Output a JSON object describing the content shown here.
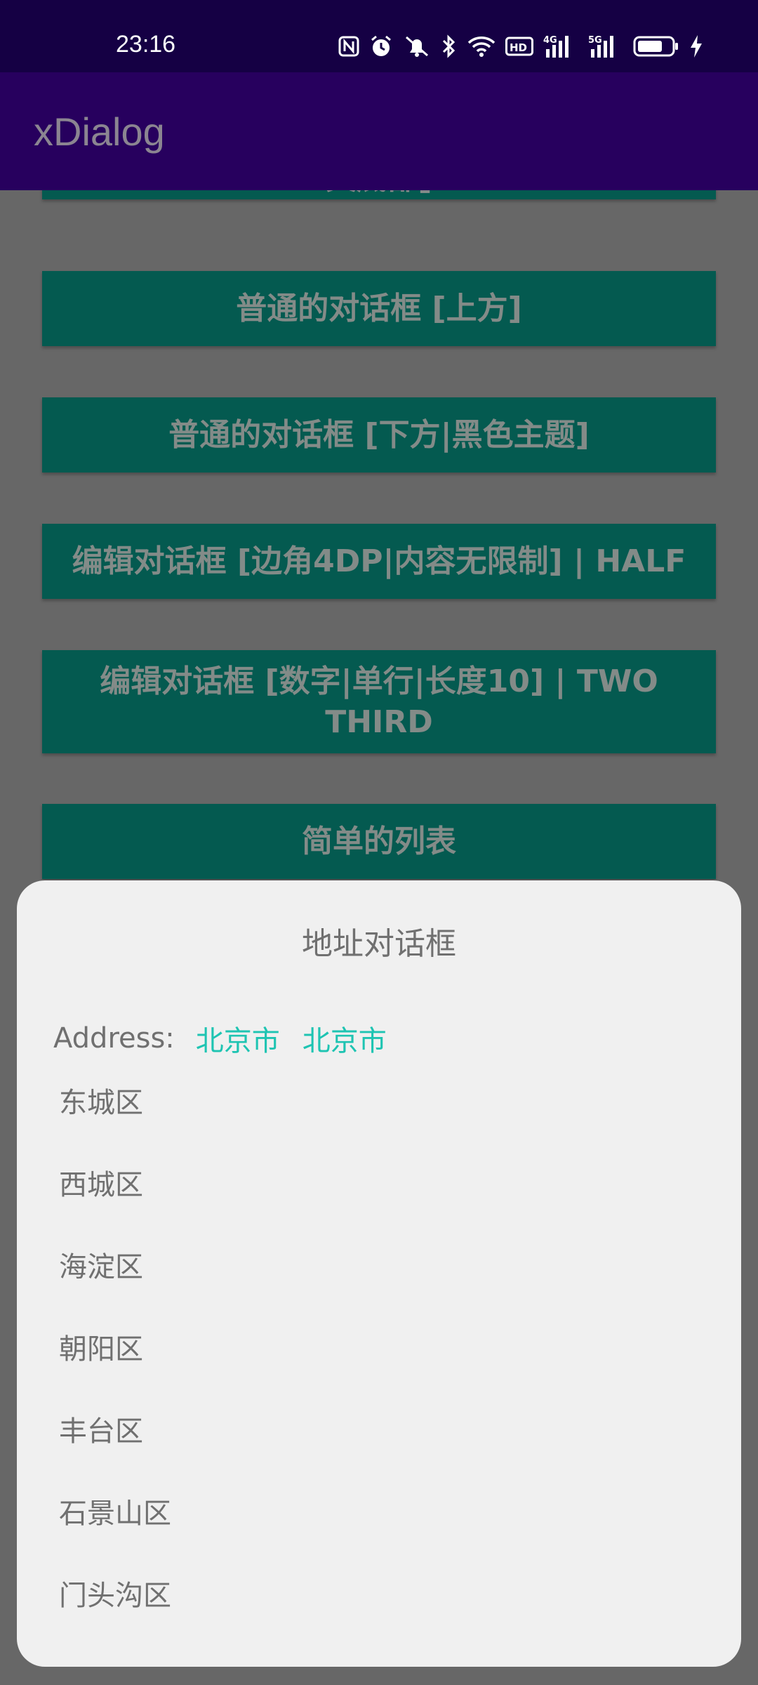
{
  "status_bar": {
    "time": "23:16",
    "icons": [
      "nfc-icon",
      "alarm-icon",
      "mute-icon",
      "bluetooth-icon",
      "wifi-icon",
      "hd-icon",
      "signal-4g-icon",
      "signal-5g-icon",
      "battery-icon",
      "charging-icon"
    ]
  },
  "app_bar": {
    "title": "xDialog"
  },
  "background_buttons": [
    {
      "label": "文底部]"
    },
    {
      "label": "普通的对话框 [上方]"
    },
    {
      "label": "普通的对话框 [下方|黑色主题]"
    },
    {
      "label": "编辑对话框 [边角4DP|内容无限制] | HALF"
    },
    {
      "label": "编辑对话框 [数字|单行|长度10] | TWO THIRD"
    },
    {
      "label": "简单的列表"
    }
  ],
  "dialog": {
    "title": "地址对话框",
    "address_label": "Address:",
    "address_parts": [
      "北京市",
      "北京市"
    ],
    "districts": [
      "东城区",
      "西城区",
      "海淀区",
      "朝阳区",
      "丰台区",
      "石景山区",
      "门头沟区"
    ]
  },
  "colors": {
    "status_bar": "#150044",
    "app_bar": "#27005e",
    "button": "#045a50",
    "accent": "#1ec4b2",
    "dialog_bg": "#f0f0f0"
  }
}
